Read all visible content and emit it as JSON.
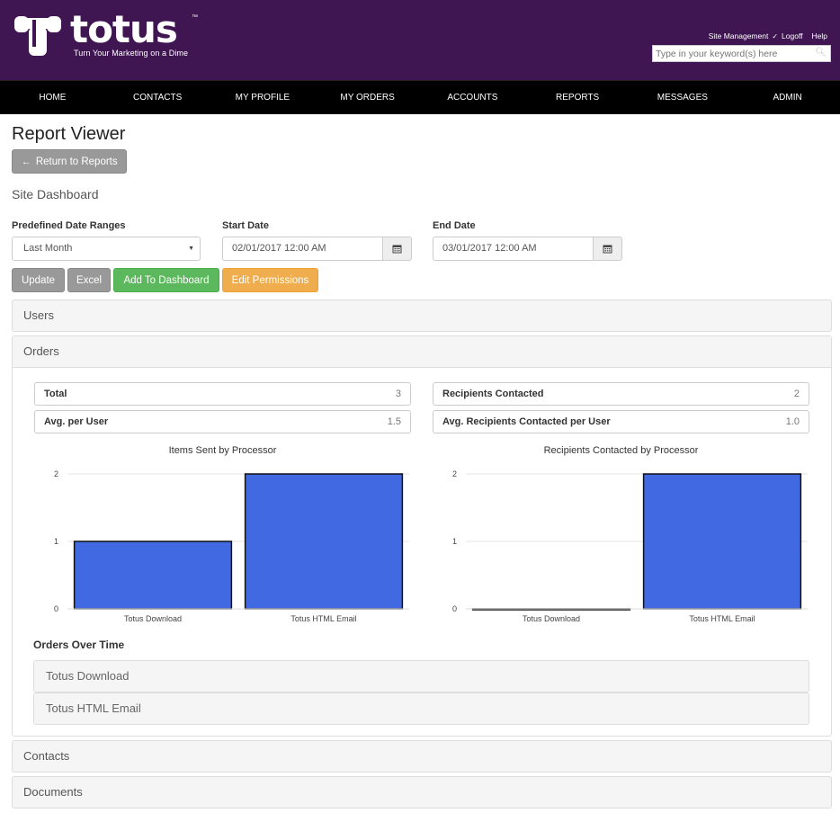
{
  "header": {
    "logo_word": "totus",
    "logo_tm": "™",
    "tagline": "Turn Your Marketing on a Dime",
    "util_links": [
      "Site Management",
      "Logoff",
      "Help"
    ],
    "util_sep": "✓",
    "search_placeholder": "Type in your keyword(s) here"
  },
  "nav": [
    "HOME",
    "CONTACTS",
    "MY PROFILE",
    "MY ORDERS",
    "ACCOUNTS",
    "REPORTS",
    "MESSAGES",
    "ADMIN"
  ],
  "page": {
    "title": "Report Viewer",
    "return_button": "Return to Reports",
    "subtitle": "Site Dashboard"
  },
  "filters": {
    "predefined_label": "Predefined Date Ranges",
    "predefined_value": "Last Month",
    "start_label": "Start Date",
    "start_value": "02/01/2017 12:00 AM",
    "end_label": "End Date",
    "end_value": "03/01/2017 12:00 AM"
  },
  "buttons": {
    "update": "Update",
    "excel": "Excel",
    "add_dashboard": "Add To Dashboard",
    "edit_permissions": "Edit Permissions"
  },
  "panels": {
    "users": "Users",
    "orders": "Orders",
    "contacts": "Contacts",
    "documents": "Documents"
  },
  "stats": {
    "total_label": "Total",
    "total_value": "3",
    "avg_label": "Avg. per User",
    "avg_value": "1.5",
    "recip_label": "Recipients Contacted",
    "recip_value": "2",
    "avg_recip_label": "Avg. Recipients Contacted per User",
    "avg_recip_value": "1.0"
  },
  "chart_data": [
    {
      "type": "bar",
      "title": "Items Sent by Processor",
      "categories": [
        "Totus Download",
        "Totus HTML Email"
      ],
      "values": [
        1,
        2
      ],
      "ylim": [
        0,
        2
      ],
      "yticks": [
        "0",
        "1",
        "2"
      ],
      "color": "#4169e1",
      "grid": true
    },
    {
      "type": "bar",
      "title": "Recipients Contacted by Processor",
      "categories": [
        "Totus Download",
        "Totus HTML Email"
      ],
      "values": [
        0,
        2
      ],
      "ylim": [
        0,
        2
      ],
      "yticks": [
        "0",
        "1",
        "2"
      ],
      "color": "#4169e1",
      "grid": true
    }
  ],
  "orders_over_time": {
    "title": "Orders Over Time",
    "items": [
      "Totus Download",
      "Totus HTML Email"
    ]
  }
}
